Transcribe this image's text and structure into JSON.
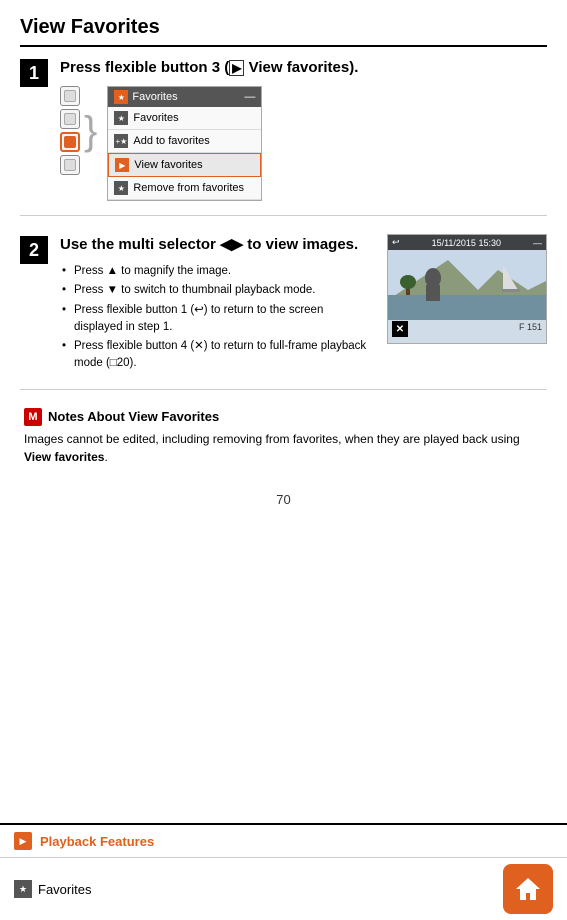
{
  "page": {
    "title": "View Favorites",
    "page_number": "70"
  },
  "step1": {
    "number": "1",
    "instruction": "Press flexible button 3 (",
    "instruction_icon": "▶",
    "instruction_end": " View favorites).",
    "highlight": "View favorites",
    "menu": {
      "header": "Favorites",
      "items": [
        {
          "label": "Favorites",
          "selected": false
        },
        {
          "label": "Add to favorites",
          "selected": false
        },
        {
          "label": "View favorites",
          "selected": true
        },
        {
          "label": "Remove from favorites",
          "selected": false
        }
      ]
    }
  },
  "step2": {
    "number": "2",
    "instruction": "Use the multi selector ",
    "direction": "◀▶",
    "instruction_end": " to view images.",
    "timestamp": "15/11/2015 15:30",
    "frame_count": "151",
    "bullets": [
      "Press ▲ to magnify the image.",
      "Press ▼ to switch to thumbnail playback mode.",
      "Press flexible button 1 (↩) to return to the screen displayed in step 1.",
      "Press flexible button 4 (✕) to return to full-frame playback mode (□20)."
    ]
  },
  "notes": {
    "icon": "M",
    "title": "Notes About View Favorites",
    "body": "Images cannot be edited, including removing from favorites, when they are played back using ",
    "highlight": "View favorites",
    "body_end": "."
  },
  "footer": {
    "playback_label": "Playback Features",
    "favorites_label": "Favorites"
  }
}
